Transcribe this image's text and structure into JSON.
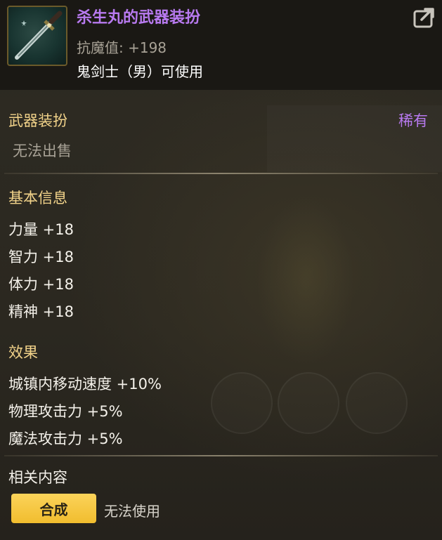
{
  "item": {
    "title": "杀生丸的武器装扮",
    "stat": "抗魔值: +198",
    "usable_by": "鬼剑士（男）可使用",
    "icon": "sword-icon"
  },
  "share": {
    "icon": "share-icon"
  },
  "category": {
    "label": "武器装扮",
    "rarity": "稀有",
    "sell_status": "无法出售"
  },
  "basic_info": {
    "heading": "基本信息",
    "stats": [
      "力量 +18",
      "智力 +18",
      "体力 +18",
      "精神 +18"
    ]
  },
  "effects": {
    "heading": "效果",
    "items": [
      "城镇内移动速度 +10%",
      "物理攻击力 +5%",
      "魔法攻击力 +5%"
    ]
  },
  "related": {
    "heading": "相关内容",
    "combine_label": "合成",
    "status": "无法使用"
  },
  "colors": {
    "rarity_purple": "#b87af0",
    "heading_gold": "#f2d38a",
    "button_yellow": "#f1bd2e"
  }
}
